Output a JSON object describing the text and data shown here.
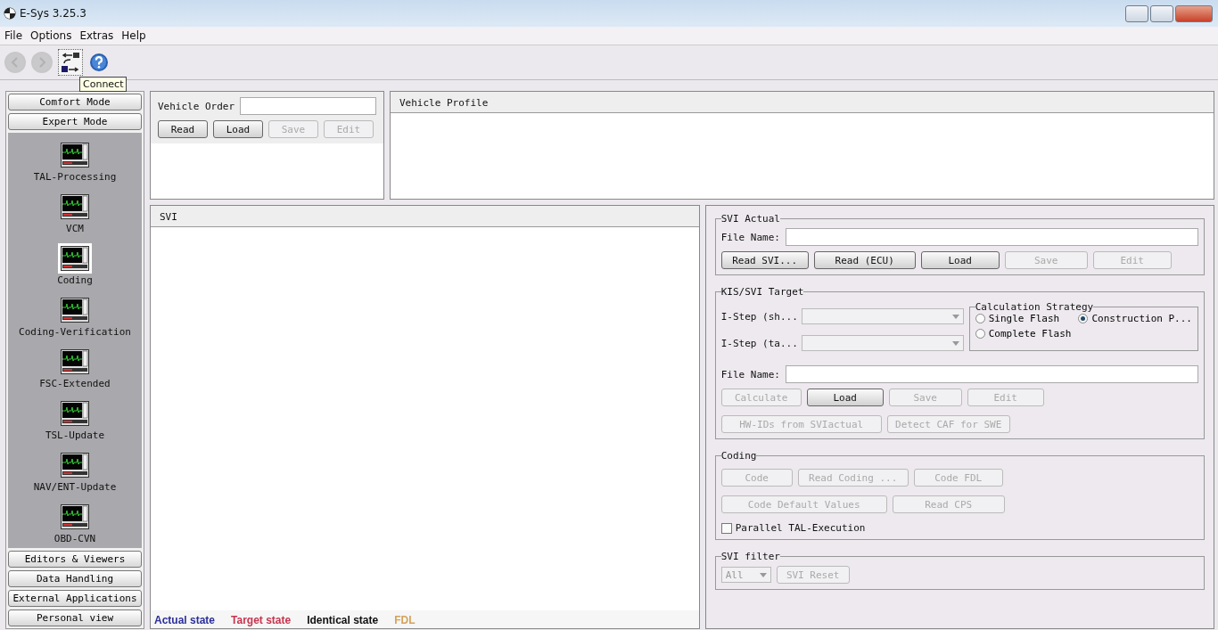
{
  "window": {
    "title": "E-Sys 3.25.3"
  },
  "menu": [
    "File",
    "Options",
    "Extras",
    "Help"
  ],
  "toolbar": [
    {
      "kind": "back",
      "disabled": true
    },
    {
      "kind": "forward",
      "disabled": true
    },
    {
      "kind": "connect",
      "disabled": false
    },
    {
      "kind": "help",
      "disabled": false
    }
  ],
  "tooltip": "Connect",
  "sidebar": {
    "top_buttons": [
      "Comfort Mode",
      "Expert Mode"
    ],
    "items": [
      {
        "label": "TAL-Processing",
        "selected": false
      },
      {
        "label": "VCM",
        "selected": false
      },
      {
        "label": "Coding",
        "selected": true
      },
      {
        "label": "Coding-Verification",
        "selected": false
      },
      {
        "label": "FSC-Extended",
        "selected": false
      },
      {
        "label": "TSL-Update",
        "selected": false
      },
      {
        "label": "NAV/ENT-Update",
        "selected": false
      },
      {
        "label": "OBD-CVN",
        "selected": false
      }
    ],
    "bottom_buttons": [
      "Editors & Viewers",
      "Data Handling",
      "External Applications",
      "Personal view"
    ]
  },
  "vehicle_order": {
    "label": "Vehicle Order",
    "buttons": [
      {
        "label": "Read",
        "disabled": false
      },
      {
        "label": "Load",
        "disabled": false
      },
      {
        "label": "Save",
        "disabled": true
      },
      {
        "label": "Edit",
        "disabled": true
      }
    ]
  },
  "vehicle_profile": {
    "title": "Vehicle Profile"
  },
  "svi": {
    "title": "SVI",
    "legend": [
      {
        "label": "Actual state",
        "color": "#2b2f9a"
      },
      {
        "label": "Target state",
        "color": "#c8344e"
      },
      {
        "label": "Identical state",
        "color": "#111111"
      },
      {
        "label": "FDL",
        "color": "#d4a35a"
      }
    ]
  },
  "svi_actual": {
    "title": "SVI Actual",
    "file_label": "File Name:",
    "buttons": [
      {
        "label": "Read SVI...",
        "disabled": false
      },
      {
        "label": "Read (ECU)",
        "disabled": false
      },
      {
        "label": "Load",
        "disabled": false
      },
      {
        "label": "Save",
        "disabled": true
      },
      {
        "label": "Edit",
        "disabled": true
      }
    ]
  },
  "kis_target": {
    "title": "KIS/SVI Target",
    "isteps": [
      {
        "label": "I-Step (sh...",
        "disabled": true
      },
      {
        "label": "I-Step (ta...",
        "disabled": true
      }
    ],
    "strategy": {
      "title": "Calculation Strategy",
      "options": [
        {
          "label": "Single Flash",
          "selected": false
        },
        {
          "label": "Construction P...",
          "selected": true
        },
        {
          "label": "Complete Flash",
          "selected": false
        }
      ]
    },
    "file_label": "File Name:",
    "buttons": [
      {
        "label": "Calculate",
        "disabled": true
      },
      {
        "label": "Load",
        "disabled": false
      },
      {
        "label": "Save",
        "disabled": true
      },
      {
        "label": "Edit",
        "disabled": true
      }
    ],
    "buttons2": [
      {
        "label": "HW-IDs from SVIactual",
        "disabled": true
      },
      {
        "label": "Detect CAF for SWE",
        "disabled": true
      }
    ]
  },
  "coding": {
    "title": "Coding",
    "buttons": [
      {
        "label": "Code",
        "disabled": true
      },
      {
        "label": "Read Coding ...",
        "disabled": true
      },
      {
        "label": "Code FDL",
        "disabled": true
      }
    ],
    "buttons2": [
      {
        "label": "Code Default Values",
        "disabled": true
      },
      {
        "label": "Read CPS",
        "disabled": true
      }
    ],
    "checkbox": {
      "label": "Parallel TAL-Execution",
      "checked": false
    }
  },
  "svi_filter": {
    "title": "SVI filter",
    "select": "All",
    "select_disabled": true,
    "button": {
      "label": "SVI Reset",
      "disabled": true
    }
  }
}
